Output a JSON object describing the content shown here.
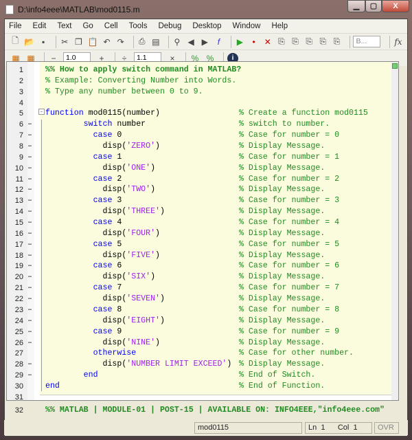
{
  "window": {
    "title": "D:\\info4eee\\MATLAB\\mod0115.m",
    "minimize": "▁",
    "maximize": "▢",
    "close": "X"
  },
  "menu": [
    "File",
    "Edit",
    "Text",
    "Go",
    "Cell",
    "Tools",
    "Debug",
    "Desktop",
    "Window",
    "Help"
  ],
  "toolbar": {
    "stack_selector": "B...",
    "fx": "fx"
  },
  "cell_toolbar": {
    "minus": "−",
    "value1": "1.0",
    "plus": "+",
    "divide": "÷",
    "value2": "1.1",
    "times": "×"
  },
  "colors": {
    "keyword": "#0000ff",
    "string": "#a020f0",
    "comment": "#228b22",
    "cell_bg": "#fbfbde"
  },
  "lines": [
    {
      "n": "1",
      "dash": "",
      "code": [
        {
          "t": "cb",
          "v": "%% How to apply switch command in MATLAB?"
        }
      ],
      "comment": ""
    },
    {
      "n": "2",
      "dash": "",
      "code": [
        {
          "t": "c",
          "v": "% Example: Converting Number into Words."
        }
      ],
      "comment": ""
    },
    {
      "n": "3",
      "dash": "",
      "code": [
        {
          "t": "c",
          "v": "% Type any number between 0 to 9."
        }
      ],
      "comment": ""
    },
    {
      "n": "4",
      "dash": "",
      "code": [],
      "comment": ""
    },
    {
      "n": "5",
      "dash": "",
      "code": [
        {
          "t": "kw",
          "v": "function"
        },
        {
          "t": "tx",
          "v": " mod0115(number)"
        }
      ],
      "comment": "% Create a function mod0115"
    },
    {
      "n": "6",
      "dash": "–",
      "code": [
        {
          "t": "tx",
          "v": "        "
        },
        {
          "t": "kw",
          "v": "switch"
        },
        {
          "t": "tx",
          "v": " number"
        }
      ],
      "comment": "% switch to number."
    },
    {
      "n": "7",
      "dash": "–",
      "code": [
        {
          "t": "tx",
          "v": "          "
        },
        {
          "t": "kw",
          "v": "case"
        },
        {
          "t": "tx",
          "v": " 0"
        }
      ],
      "comment": "% Case for number = 0"
    },
    {
      "n": "8",
      "dash": "–",
      "code": [
        {
          "t": "tx",
          "v": "            disp("
        },
        {
          "t": "str",
          "v": "'ZERO'"
        },
        {
          "t": "tx",
          "v": ")"
        }
      ],
      "comment": "% Display Message."
    },
    {
      "n": "9",
      "dash": "–",
      "code": [
        {
          "t": "tx",
          "v": "          "
        },
        {
          "t": "kw",
          "v": "case"
        },
        {
          "t": "tx",
          "v": " 1"
        }
      ],
      "comment": "% Case for number = 1"
    },
    {
      "n": "10",
      "dash": "–",
      "code": [
        {
          "t": "tx",
          "v": "            disp("
        },
        {
          "t": "str",
          "v": "'ONE'"
        },
        {
          "t": "tx",
          "v": ")"
        }
      ],
      "comment": "% Display Message."
    },
    {
      "n": "11",
      "dash": "–",
      "code": [
        {
          "t": "tx",
          "v": "          "
        },
        {
          "t": "kw",
          "v": "case"
        },
        {
          "t": "tx",
          "v": " 2"
        }
      ],
      "comment": "% Case for number = 2"
    },
    {
      "n": "12",
      "dash": "–",
      "code": [
        {
          "t": "tx",
          "v": "            disp("
        },
        {
          "t": "str",
          "v": "'TWO'"
        },
        {
          "t": "tx",
          "v": ")"
        }
      ],
      "comment": "% Display Message."
    },
    {
      "n": "13",
      "dash": "–",
      "code": [
        {
          "t": "tx",
          "v": "          "
        },
        {
          "t": "kw",
          "v": "case"
        },
        {
          "t": "tx",
          "v": " 3"
        }
      ],
      "comment": "% Case for number = 3"
    },
    {
      "n": "14",
      "dash": "–",
      "code": [
        {
          "t": "tx",
          "v": "            disp("
        },
        {
          "t": "str",
          "v": "'THREE'"
        },
        {
          "t": "tx",
          "v": ")"
        }
      ],
      "comment": "% Display Message."
    },
    {
      "n": "15",
      "dash": "–",
      "code": [
        {
          "t": "tx",
          "v": "          "
        },
        {
          "t": "kw",
          "v": "case"
        },
        {
          "t": "tx",
          "v": " 4"
        }
      ],
      "comment": "% Case for number = 4"
    },
    {
      "n": "16",
      "dash": "–",
      "code": [
        {
          "t": "tx",
          "v": "            disp("
        },
        {
          "t": "str",
          "v": "'FOUR'"
        },
        {
          "t": "tx",
          "v": ")"
        }
      ],
      "comment": "% Display Message."
    },
    {
      "n": "17",
      "dash": "–",
      "code": [
        {
          "t": "tx",
          "v": "          "
        },
        {
          "t": "kw",
          "v": "case"
        },
        {
          "t": "tx",
          "v": " 5"
        }
      ],
      "comment": "% Case for number = 5"
    },
    {
      "n": "18",
      "dash": "–",
      "code": [
        {
          "t": "tx",
          "v": "            disp("
        },
        {
          "t": "str",
          "v": "'FIVE'"
        },
        {
          "t": "tx",
          "v": ")"
        }
      ],
      "comment": "% Display Message."
    },
    {
      "n": "19",
      "dash": "–",
      "code": [
        {
          "t": "tx",
          "v": "          "
        },
        {
          "t": "kw",
          "v": "case"
        },
        {
          "t": "tx",
          "v": " 6"
        }
      ],
      "comment": "% Case for number = 6"
    },
    {
      "n": "20",
      "dash": "–",
      "code": [
        {
          "t": "tx",
          "v": "            disp("
        },
        {
          "t": "str",
          "v": "'SIX'"
        },
        {
          "t": "tx",
          "v": ")"
        }
      ],
      "comment": "% Display Message."
    },
    {
      "n": "21",
      "dash": "–",
      "code": [
        {
          "t": "tx",
          "v": "          "
        },
        {
          "t": "kw",
          "v": "case"
        },
        {
          "t": "tx",
          "v": " 7"
        }
      ],
      "comment": "% Case for number = 7"
    },
    {
      "n": "22",
      "dash": "–",
      "code": [
        {
          "t": "tx",
          "v": "            disp("
        },
        {
          "t": "str",
          "v": "'SEVEN'"
        },
        {
          "t": "tx",
          "v": ")"
        }
      ],
      "comment": "% Display Message."
    },
    {
      "n": "23",
      "dash": "–",
      "code": [
        {
          "t": "tx",
          "v": "          "
        },
        {
          "t": "kw",
          "v": "case"
        },
        {
          "t": "tx",
          "v": " 8"
        }
      ],
      "comment": "% Case for number = 8"
    },
    {
      "n": "24",
      "dash": "–",
      "code": [
        {
          "t": "tx",
          "v": "            disp("
        },
        {
          "t": "str",
          "v": "'EIGHT'"
        },
        {
          "t": "tx",
          "v": ")"
        }
      ],
      "comment": "% Display Message."
    },
    {
      "n": "25",
      "dash": "–",
      "code": [
        {
          "t": "tx",
          "v": "          "
        },
        {
          "t": "kw",
          "v": "case"
        },
        {
          "t": "tx",
          "v": " 9"
        }
      ],
      "comment": "% Case for number = 9"
    },
    {
      "n": "26",
      "dash": "–",
      "code": [
        {
          "t": "tx",
          "v": "            disp("
        },
        {
          "t": "str",
          "v": "'NINE'"
        },
        {
          "t": "tx",
          "v": ")"
        }
      ],
      "comment": "% Display Message."
    },
    {
      "n": "27",
      "dash": "",
      "code": [
        {
          "t": "tx",
          "v": "          "
        },
        {
          "t": "kw",
          "v": "otherwise"
        }
      ],
      "comment": "% Case for other number."
    },
    {
      "n": "28",
      "dash": "–",
      "code": [
        {
          "t": "tx",
          "v": "            disp("
        },
        {
          "t": "str",
          "v": "'NUMBER LIMIT EXCEED'"
        },
        {
          "t": "tx",
          "v": ")"
        }
      ],
      "comment": "% Display Message."
    },
    {
      "n": "29",
      "dash": "–",
      "code": [
        {
          "t": "tx",
          "v": "        "
        },
        {
          "t": "kw",
          "v": "end"
        }
      ],
      "comment": "% End of Switch."
    },
    {
      "n": "30",
      "dash": "",
      "code": [
        {
          "t": "kw",
          "v": "end"
        }
      ],
      "comment": "% End of Function."
    },
    {
      "n": "31",
      "dash": "",
      "code": [],
      "comment": ""
    },
    {
      "n": "32",
      "dash": "",
      "code": [
        {
          "t": "cb",
          "v": "%% MATLAB | MODULE-01 | POST-15 | AVAILABLE ON: INFO4EEE,\"info4eee.com\""
        }
      ],
      "comment": ""
    }
  ],
  "status": {
    "file": "mod0115",
    "ln_label": "Ln",
    "ln": "1",
    "col_label": "Col",
    "col": "1",
    "mode": "OVR"
  }
}
